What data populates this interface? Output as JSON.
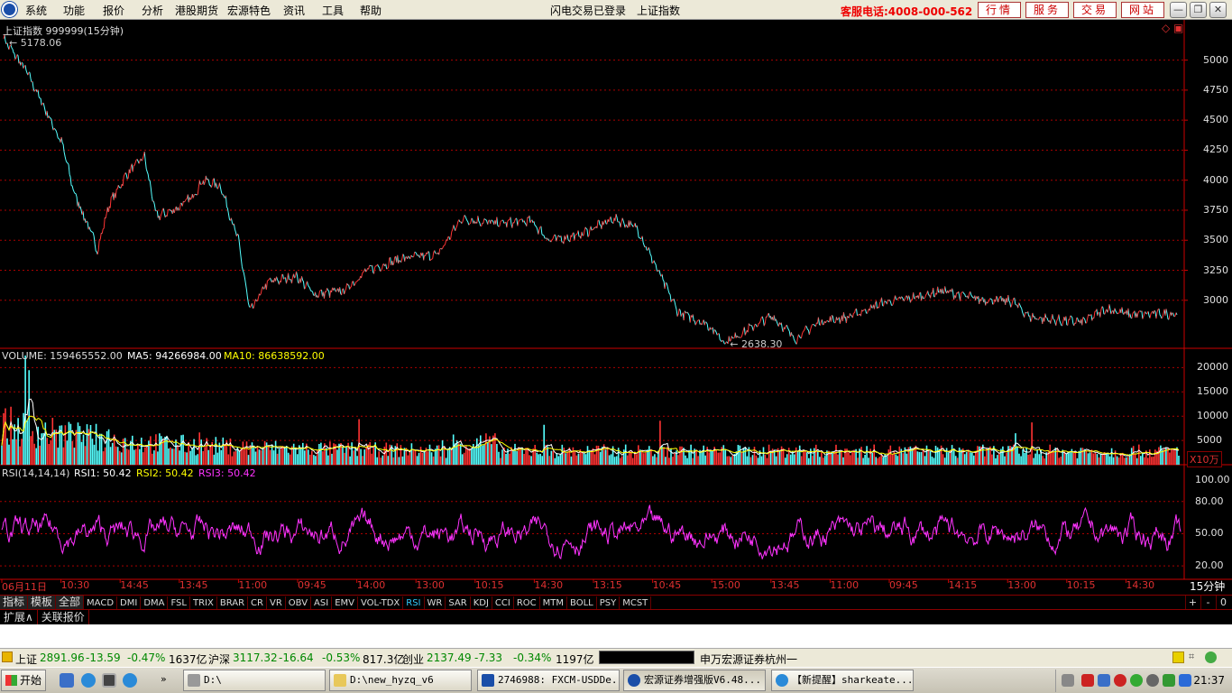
{
  "menubar": {
    "items": [
      "系统",
      "功能",
      "报价",
      "分析",
      "港股期货",
      "宏源特色",
      "资讯",
      "工具",
      "帮助"
    ],
    "status_login": "闪电交易已登录",
    "status_index": "上证指数",
    "hotline": "客服电话:4008-000-562",
    "quick_buttons": [
      "行情",
      "服务",
      "交易",
      "网站"
    ]
  },
  "chart_panel": {
    "title": "上证指数 999999(15分钟)",
    "high_label": "5178.06",
    "low_label": "2638.30",
    "volume_header": {
      "volume": "VOLUME: 159465552.00",
      "ma5": "MA5: 94266984.00",
      "ma10": "MA10: 86638592.00"
    },
    "volume_unit": "X10万",
    "rsi_header": {
      "name": "RSI(14,14,14)",
      "rsi1": "RSI1: 50.42",
      "rsi2": "RSI2: 50.42",
      "rsi3": "RSI3: 50.42"
    },
    "period_label": "15分钟",
    "colors": {
      "up": "#ff3333",
      "down": "#55ffff",
      "ma5": "#ffffff",
      "ma10": "#ffff00",
      "rsi": "#ff33ff",
      "grid": "#aa0000"
    }
  },
  "chart_data": [
    {
      "type": "line",
      "name": "price",
      "y_ticks": [
        3000,
        3250,
        3500,
        3750,
        4000,
        4250,
        4500,
        4750,
        5000
      ],
      "ylim": [
        2600,
        5200
      ],
      "high": 5178.06,
      "low": 2638.3,
      "x_ticks": [
        "06月11日",
        "10:30",
        "14:45",
        "13:45",
        "11:00",
        "09:45",
        "14:00",
        "13:00",
        "10:15",
        "14:30",
        "13:15",
        "10:45",
        "15:00",
        "13:45",
        "11:00",
        "09:45",
        "14:15",
        "13:00",
        "10:15",
        "14:30"
      ],
      "anchors": [
        [
          0,
          5178
        ],
        [
          0.02,
          4900
        ],
        [
          0.035,
          4600
        ],
        [
          0.05,
          4300
        ],
        [
          0.06,
          3900
        ],
        [
          0.075,
          3550
        ],
        [
          0.08,
          3420
        ],
        [
          0.09,
          3800
        ],
        [
          0.105,
          4050
        ],
        [
          0.12,
          4200
        ],
        [
          0.13,
          3700
        ],
        [
          0.145,
          3750
        ],
        [
          0.16,
          3850
        ],
        [
          0.17,
          4000
        ],
        [
          0.185,
          3950
        ],
        [
          0.2,
          3500
        ],
        [
          0.21,
          2900
        ],
        [
          0.225,
          3150
        ],
        [
          0.25,
          3200
        ],
        [
          0.265,
          3050
        ],
        [
          0.29,
          3080
        ],
        [
          0.31,
          3250
        ],
        [
          0.34,
          3350
        ],
        [
          0.37,
          3380
        ],
        [
          0.39,
          3680
        ],
        [
          0.42,
          3640
        ],
        [
          0.45,
          3660
        ],
        [
          0.465,
          3500
        ],
        [
          0.49,
          3540
        ],
        [
          0.52,
          3680
        ],
        [
          0.54,
          3600
        ],
        [
          0.555,
          3300
        ],
        [
          0.575,
          2900
        ],
        [
          0.6,
          2800
        ],
        [
          0.615,
          2650
        ],
        [
          0.635,
          2760
        ],
        [
          0.655,
          2870
        ],
        [
          0.675,
          2680
        ],
        [
          0.695,
          2820
        ],
        [
          0.72,
          2860
        ],
        [
          0.75,
          2980
        ],
        [
          0.78,
          3030
        ],
        [
          0.8,
          3080
        ],
        [
          0.83,
          3010
        ],
        [
          0.86,
          2990
        ],
        [
          0.875,
          2860
        ],
        [
          0.9,
          2830
        ],
        [
          0.92,
          2820
        ],
        [
          0.94,
          2930
        ],
        [
          0.96,
          2880
        ],
        [
          1.0,
          2891
        ]
      ]
    },
    {
      "type": "bar",
      "name": "VOLUME",
      "y_ticks": [
        5000,
        10000,
        15000,
        20000
      ],
      "ylim": [
        0,
        21000
      ]
    },
    {
      "type": "line",
      "name": "RSI",
      "y_ticks": [
        20.0,
        50.0,
        80.0,
        100.0
      ],
      "ylim": [
        10,
        100
      ]
    }
  ],
  "indicator_tabs": [
    "指标",
    "模板",
    "全部",
    "MACD",
    "DMI",
    "DMA",
    "FSL",
    "TRIX",
    "BRAR",
    "CR",
    "VR",
    "OBV",
    "ASI",
    "EMV",
    "VOL-TDX",
    "RSI",
    "WR",
    "SAR",
    "KDJ",
    "CCI",
    "ROC",
    "MTM",
    "BOLL",
    "PSY",
    "MCST"
  ],
  "active_tab": "RSI",
  "zoom_buttons": [
    "+",
    "-",
    "0"
  ],
  "sub_tabs": [
    "扩展∧",
    "关联报价"
  ],
  "statusbar": {
    "sh_name": "上证",
    "sh_value": "2891.96",
    "sh_change": "-13.59",
    "sh_pct": "-0.47%",
    "sh_amount": "1637亿",
    "hs_name": "沪深",
    "hs_value": "3117.32",
    "hs_change": "-16.64",
    "hs_pct": "-0.53%",
    "hs_amount": "817.3亿",
    "cy_name": "创业",
    "cy_value": "2137.49",
    "cy_change": "-7.33",
    "cy_pct": "-0.34%",
    "cy_amount": "1197亿",
    "broker": "申万宏源证券杭州一"
  },
  "taskbar": {
    "start": "开始",
    "tasks": [
      "D:\\",
      "D:\\new_hyzq_v6",
      "2746988: FXCM-USDDe...",
      "宏源证券增强版V6.48...",
      "【新提醒】sharkeate..."
    ],
    "clock": "21:37"
  }
}
